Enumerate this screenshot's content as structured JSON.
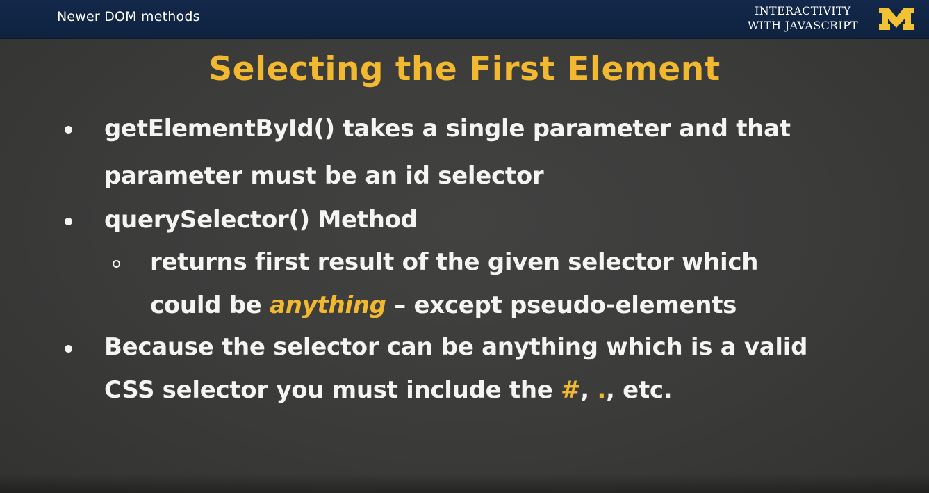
{
  "header": {
    "section_title": "Newer DOM methods",
    "course_title_line1": "INTERACTIVITY",
    "course_title_line2": "WITH JAVASCRIPT",
    "logo_letter": "M"
  },
  "colors": {
    "header_bg": "#13284a",
    "accent": "#f2b830",
    "text": "#f4f4f2",
    "background": "#3a3a39"
  },
  "slide": {
    "title": "Selecting the First Element",
    "bullets": [
      {
        "line1": "getElementById() takes a single parameter and that",
        "line2": "parameter must be an id selector"
      },
      {
        "line1": "querySelector() Method",
        "sub": {
          "line1": "returns first result of the given selector which",
          "line2_before": "could be ",
          "line2_emphasis": "anything",
          "line2_after": " – except pseudo-elements"
        }
      },
      {
        "line1": "Because the selector can be anything which is a valid",
        "line2_before": "CSS selector you must include the ",
        "line2_hash": "#",
        "line2_comma1": ", ",
        "line2_dot": ".",
        "line2_after": ", etc."
      }
    ]
  }
}
